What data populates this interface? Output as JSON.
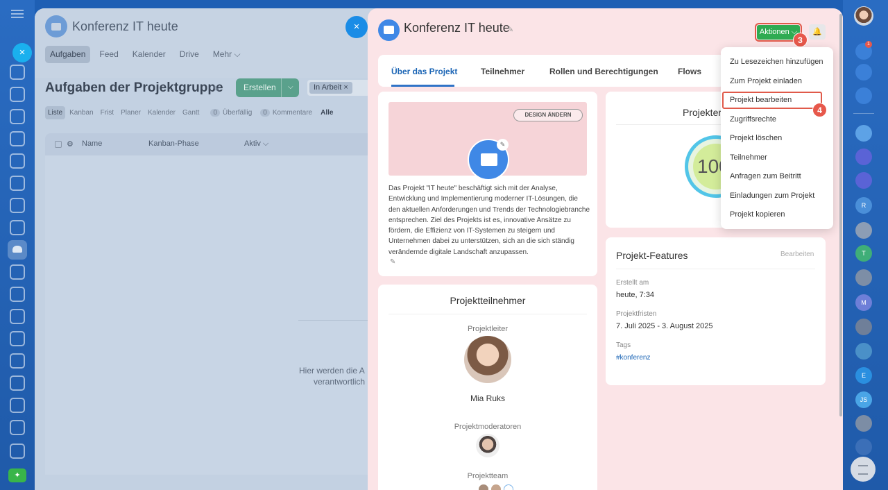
{
  "background": {
    "project_title": "Konferenz IT heute",
    "tabs": [
      "Aufgaben",
      "Feed",
      "Kalender",
      "Drive",
      "Mehr ⌵"
    ],
    "heading": "Aufgaben der Projektgruppe",
    "create_button": "Erstellen",
    "filter_chip": "In Arbeit ×",
    "views": [
      "Liste",
      "Kanban",
      "Frist",
      "Planer",
      "Kalender",
      "Gantt"
    ],
    "counter_overdue": {
      "count": "0",
      "label": "Überfällig"
    },
    "counter_comments": {
      "count": "0",
      "label": "Kommentare"
    },
    "counter_all": "Alle",
    "columns": [
      "Name",
      "Kanban-Phase",
      "Aktiv ⌵"
    ],
    "empty_line1": "Hier werden die A",
    "empty_line2": "verantwortlich"
  },
  "slider": {
    "title": "Konferenz IT heute",
    "actions_button": "Aktionen ⌵",
    "tabs": [
      "Über das Projekt",
      "Teilnehmer",
      "Rollen und Berechtigungen",
      "Flows"
    ],
    "design_button": "DESIGN ÄNDERN",
    "description": "Das Projekt \"IT heute\" beschäftigt sich mit der Analyse, Entwicklung und Implementierung moderner IT-Lösungen, die den aktuellen Anforderungen und Trends der Technologiebranche entsprechen. Ziel des Projekts ist es, innovative Ansätze zu fördern, die Effizienz von IT-Systemen zu steigern und Unternehmen dabei zu unterstützen, sich an die sich ständig verändernde digitale Landschaft anzupassen.",
    "participants": {
      "title": "Projektteilnehmer",
      "leader_label": "Projektleiter",
      "leader_name": "Mia Ruks",
      "moderators_label": "Projektmoderatoren",
      "team_label": "Projektteam"
    },
    "progress": {
      "title": "Projekter",
      "value": "100"
    },
    "features": {
      "title": "Projekt-Features",
      "edit": "Bearbeiten",
      "created_label": "Erstellt am",
      "created_value": "heute, 7:34",
      "deadline_label": "Projektfristen",
      "deadline_value": "7. Juli 2025 - 3. August 2025",
      "tags_label": "Tags",
      "tag": "#konferenz"
    }
  },
  "dropdown": {
    "items": [
      "Zu Lesezeichen hinzufügen",
      "Zum Projekt einladen",
      "Projekt bearbeiten",
      "Zugriffsrechte",
      "Projekt löschen",
      "Teilnehmer",
      "Anfragen zum Beitritt",
      "Einladungen zum Projekt",
      "Projekt kopieren"
    ]
  },
  "step_badges": {
    "actions": "3",
    "edit": "4"
  },
  "right_bar": {
    "notification_count": "1",
    "letters": [
      "R",
      "T",
      "M",
      "E",
      "JS"
    ]
  },
  "colors": {
    "accent_green": "#2eab52",
    "highlight_red": "#e05a4a",
    "brand_blue": "#2f73c7"
  }
}
